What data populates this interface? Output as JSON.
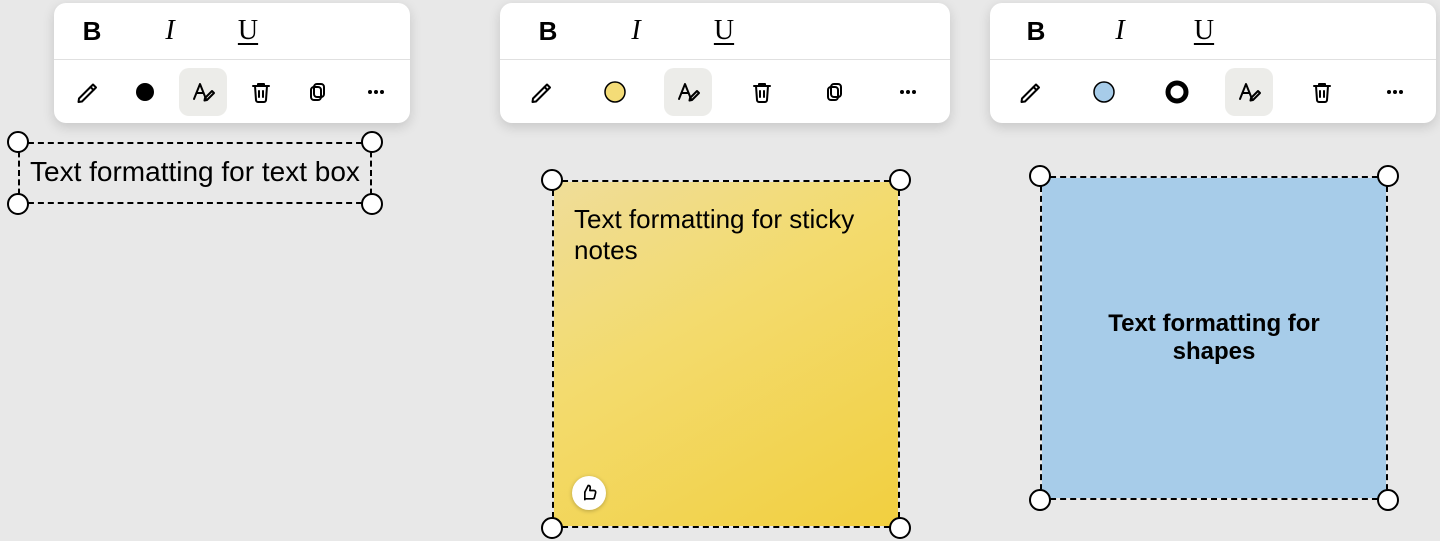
{
  "colors": {
    "sticky_fill": "#f2cf3f",
    "shape_fill": "#a7cce9",
    "shape_border": "#000000",
    "textbox_fill": "#000000"
  },
  "textbox": {
    "text": "Text formatting for text box"
  },
  "sticky": {
    "text": "Text formatting for sticky notes"
  },
  "shape": {
    "text": "Text formatting for shapes"
  },
  "common": {
    "bold": "B",
    "italic": "I",
    "underline": "U"
  }
}
